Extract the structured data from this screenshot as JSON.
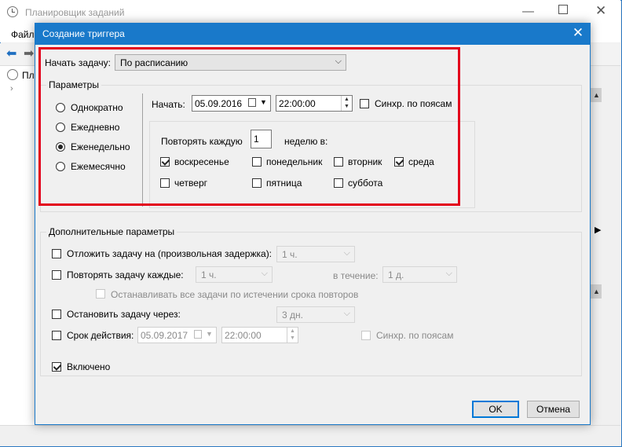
{
  "app": {
    "title": "Планировщик заданий",
    "menu_file": "Файл",
    "tree_label": "Пл"
  },
  "dialog": {
    "title": "Создание триггера",
    "start_task_label": "Начать задачу:",
    "start_task_value": "По расписанию",
    "params_title": "Параметры",
    "schedule_options": [
      "Однократно",
      "Ежедневно",
      "Еженедельно",
      "Ежемесячно"
    ],
    "selected_option": "Еженедельно",
    "start_label": "Начать:",
    "start_date": "05.09.2016",
    "start_time": "22:00:00",
    "sync_label": "Синхр. по поясам",
    "repeat_every_label": "Повторять каждую",
    "repeat_every_value": "1",
    "weeks_on_label": "неделю в:",
    "days": [
      {
        "label": "воскресенье",
        "checked": true
      },
      {
        "label": "понедельник",
        "checked": false
      },
      {
        "label": "вторник",
        "checked": false
      },
      {
        "label": "среда",
        "checked": true
      },
      {
        "label": "четверг",
        "checked": false
      },
      {
        "label": "пятница",
        "checked": false
      },
      {
        "label": "суббота",
        "checked": false
      }
    ],
    "advanced_title": "Дополнительные параметры",
    "delay_label": "Отложить задачу на (произвольная задержка):",
    "delay_value": "1 ч.",
    "repeat_label": "Повторять задачу каждые:",
    "repeat_value": "1 ч.",
    "duration_label": "в течение:",
    "duration_value": "1 д.",
    "stop_all_label": "Останавливать все задачи по истечении срока повторов",
    "stop_after_label": "Остановить задачу через:",
    "stop_after_value": "3 дн.",
    "expire_label": "Срок действия:",
    "expire_date": "05.09.2017",
    "expire_time": "22:00:00",
    "expire_sync_label": "Синхр. по поясам",
    "enabled_label": "Включено",
    "ok_label": "OK",
    "cancel_label": "Отмена"
  },
  "colors": {
    "accent": "#1979ca",
    "highlight": "#e3001b"
  }
}
